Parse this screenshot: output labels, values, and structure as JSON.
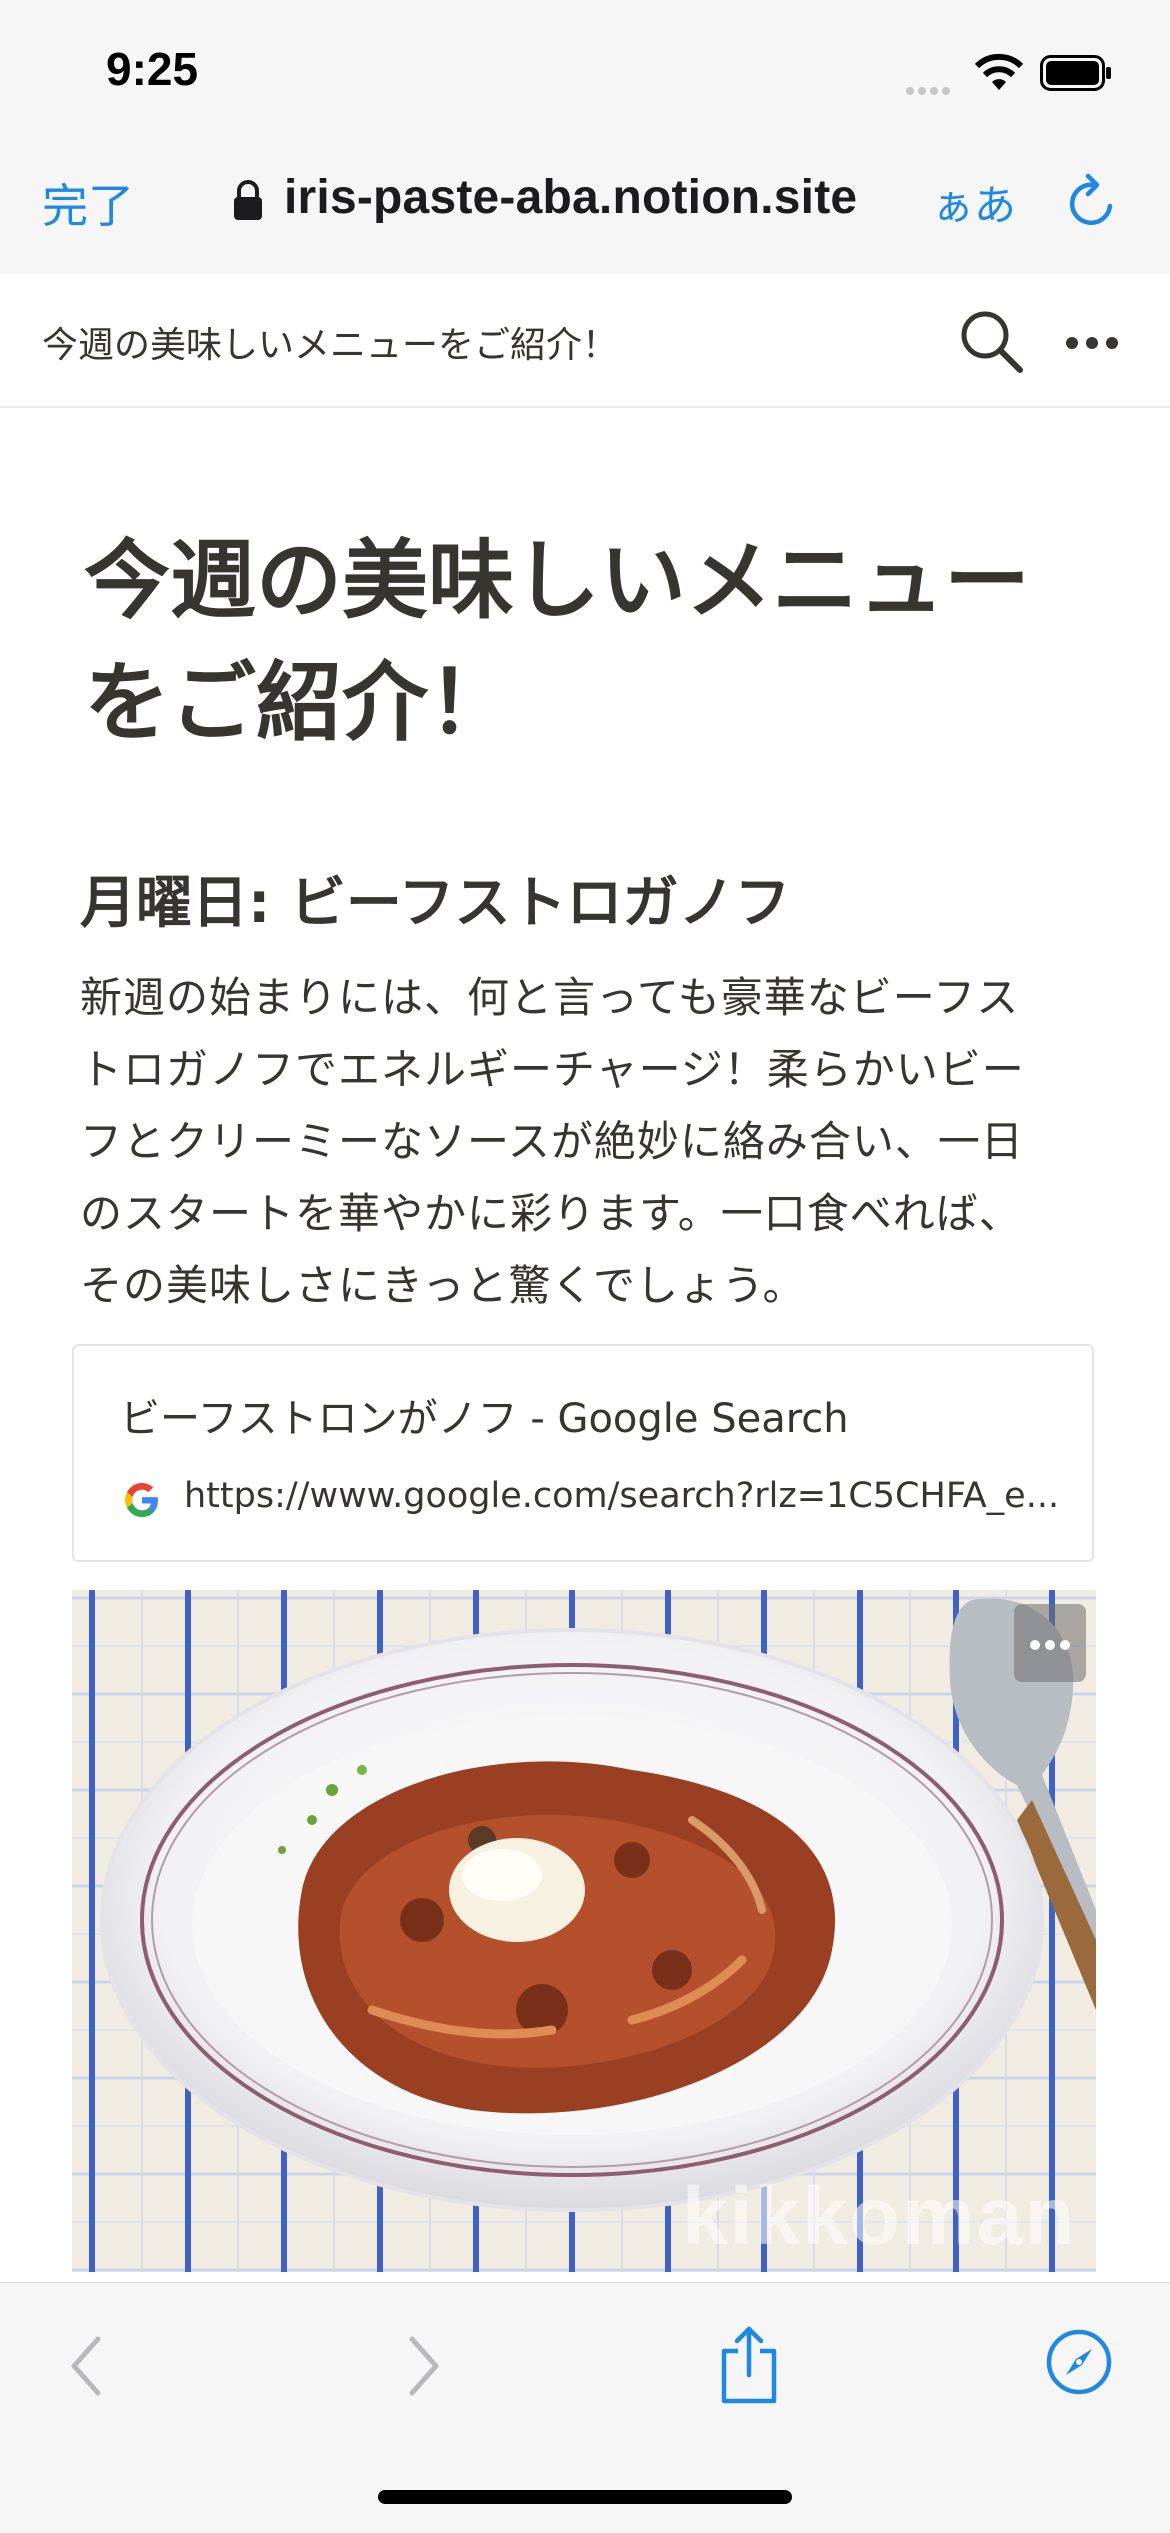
{
  "status_bar": {
    "time": "9:25"
  },
  "browser": {
    "done_label": "完了",
    "url": "iris-paste-aba.notion.site",
    "text_size_label": "ぁあ"
  },
  "notion_topbar": {
    "breadcrumb": "今週の美味しいメニューをご紹介！"
  },
  "page": {
    "title_line1": "今週の美味しいメニュー",
    "title_line2": "をご紹介！",
    "section_heading": "月曜日: ビーフストロガノフ",
    "paragraph_lines": [
      "新週の始まりには、何と言っても豪華なビーフス",
      "トロガノフでエネルギーチャージ！柔らかいビー",
      "フとクリーミーなソースが絶妙に絡み合い、一日",
      "のスタートを華やかに彩ります。一口食べれば、",
      "その美味しさにきっと驚くでしょう。"
    ],
    "bookmark": {
      "title": "ビーフストロンがノフ - Google Search",
      "url": "https://www.google.com/search?rlz=1C5CHFA_e..."
    },
    "image": {
      "watermark": "kikkoman"
    }
  },
  "colors": {
    "accent": "#1e88e5",
    "text": "#37352f",
    "bar_bg": "#f6f6f6"
  }
}
